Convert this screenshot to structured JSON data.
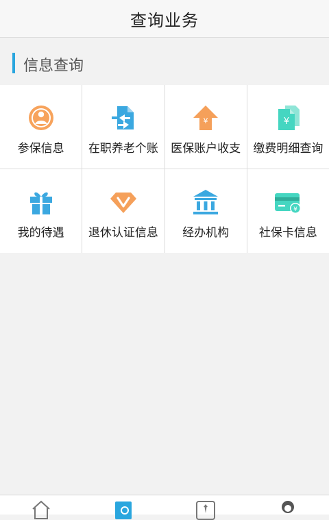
{
  "header": {
    "title": "查询业务"
  },
  "section": {
    "title": "信息查询"
  },
  "tiles": [
    {
      "label": "参保信息",
      "icon": "user-circle-icon"
    },
    {
      "label": "在职养老个账",
      "icon": "transfer-doc-icon"
    },
    {
      "label": "医保账户收支",
      "icon": "yuan-upload-icon"
    },
    {
      "label": "缴费明细查询",
      "icon": "yuan-document-icon"
    },
    {
      "label": "我的待遇",
      "icon": "gift-icon"
    },
    {
      "label": "退休认证信息",
      "icon": "diamond-v-icon"
    },
    {
      "label": "经办机构",
      "icon": "bank-building-icon"
    },
    {
      "label": "社保卡信息",
      "icon": "bank-card-icon"
    }
  ],
  "colors": {
    "accent": "#2aa6de",
    "orange": "#f5a05a",
    "blue": "#3ba8e0",
    "teal": "#45d6c1"
  },
  "tabbar": [
    {
      "icon": "home-icon"
    },
    {
      "icon": "query-icon",
      "active": true
    },
    {
      "icon": "agency-icon"
    },
    {
      "icon": "profile-icon"
    }
  ]
}
